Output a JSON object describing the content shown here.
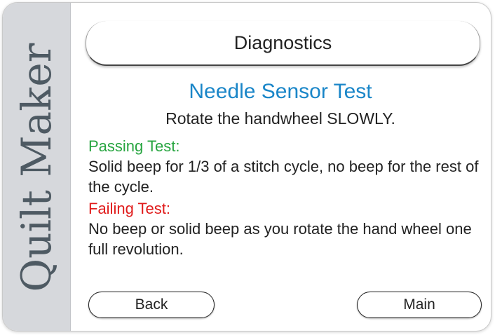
{
  "brand": {
    "name": "Quilt Maker"
  },
  "header": {
    "title": "Diagnostics"
  },
  "test": {
    "name": "Needle Sensor Test",
    "instruction": "Rotate the handwheel SLOWLY.",
    "pass_label": "Passing Test:",
    "pass_description": "Solid beep for 1/3 of a stitch cycle, no beep for the rest of the cycle.",
    "fail_label": "Failing Test:",
    "fail_description": "No beep or solid beep as you rotate the hand wheel one full revolution."
  },
  "buttons": {
    "back": "Back",
    "main": "Main"
  },
  "colors": {
    "heading": "#1a86c8",
    "pass": "#27a540",
    "fail": "#e01b1b",
    "sidebar": "#d6d8dc"
  }
}
